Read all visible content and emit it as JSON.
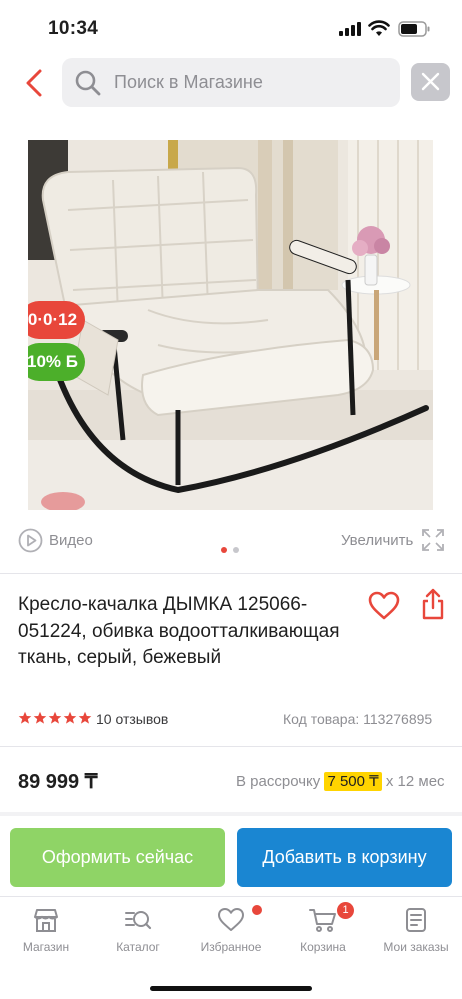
{
  "status_bar": {
    "time": "10:34"
  },
  "search": {
    "placeholder": "Поиск в Магазине"
  },
  "product": {
    "badges": {
      "timer": "0·0·12",
      "cashback": "10% Б"
    },
    "media": {
      "video_label": "Видео",
      "zoom_label": "Увеличить"
    },
    "title": "Кресло-качалка ДЫМКА 125066-051224, обивка водоотталкивающая ткань, серый, бежевый",
    "rating": {
      "stars": 5,
      "reviews": "10 отзывов"
    },
    "sku": "Код товара: 113276895",
    "price": "89 999 ₸",
    "installment": {
      "prefix": "В рассрочку",
      "amount": "7 500 ₸",
      "suffix": "х 12 мес"
    }
  },
  "actions": {
    "buy_now": "Оформить сейчас",
    "add_to_cart": "Добавить в корзину"
  },
  "tabbar": {
    "items": [
      {
        "label": "Магазин",
        "icon": "shop-icon"
      },
      {
        "label": "Каталог",
        "icon": "catalog-search-icon"
      },
      {
        "label": "Избранное",
        "icon": "heart-icon"
      },
      {
        "label": "Корзина",
        "icon": "cart-icon",
        "badge": "1"
      },
      {
        "label": "Мои заказы",
        "icon": "orders-icon"
      }
    ]
  },
  "colors": {
    "accent_red": "#e8473b",
    "green": "#4caf2a",
    "buy_green": "#8fd466",
    "cart_blue": "#1a86d2",
    "highlight_yellow": "#ffd400"
  }
}
